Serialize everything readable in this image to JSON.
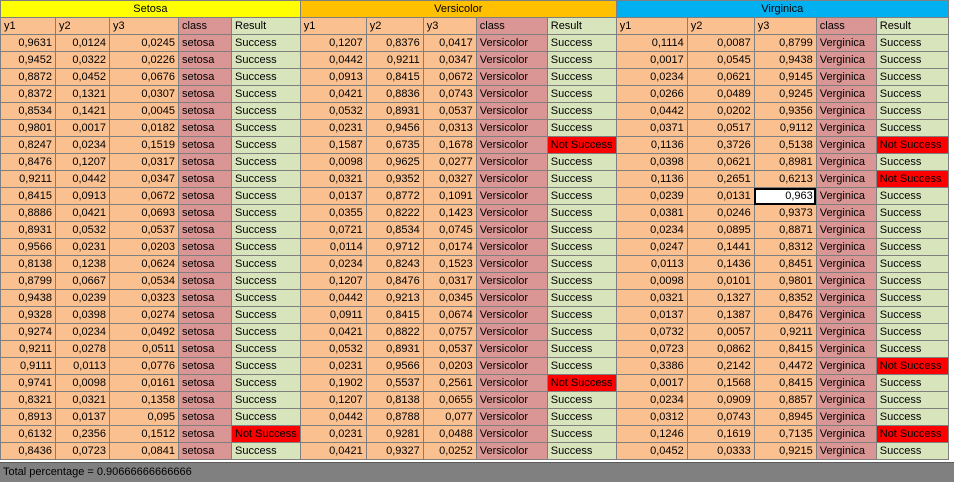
{
  "groups": [
    {
      "label": "Setosa"
    },
    {
      "label": "Versicolor"
    },
    {
      "label": "Virginica"
    }
  ],
  "headers": [
    "y1",
    "y2",
    "y3",
    "class",
    "Result"
  ],
  "rows": [
    [
      [
        "0,9631",
        "0,0124",
        "0,0245",
        "setosa",
        "Success"
      ],
      [
        "0,1207",
        "0,8376",
        "0,0417",
        "Versicolor",
        "Success"
      ],
      [
        "0,1114",
        "0,0087",
        "0,8799",
        "Verginica",
        "Success"
      ]
    ],
    [
      [
        "0,9452",
        "0,0322",
        "0,0226",
        "setosa",
        "Success"
      ],
      [
        "0,0442",
        "0,9211",
        "0,0347",
        "Versicolor",
        "Success"
      ],
      [
        "0,0017",
        "0,0545",
        "0,9438",
        "Verginica",
        "Success"
      ]
    ],
    [
      [
        "0,8872",
        "0,0452",
        "0,0676",
        "setosa",
        "Success"
      ],
      [
        "0,0913",
        "0,8415",
        "0,0672",
        "Versicolor",
        "Success"
      ],
      [
        "0,0234",
        "0,0621",
        "0,9145",
        "Verginica",
        "Success"
      ]
    ],
    [
      [
        "0,8372",
        "0,1321",
        "0,0307",
        "setosa",
        "Success"
      ],
      [
        "0,0421",
        "0,8836",
        "0,0743",
        "Versicolor",
        "Success"
      ],
      [
        "0,0266",
        "0,0489",
        "0,9245",
        "Verginica",
        "Success"
      ]
    ],
    [
      [
        "0,8534",
        "0,1421",
        "0,0045",
        "setosa",
        "Success"
      ],
      [
        "0,0532",
        "0,8931",
        "0,0537",
        "Versicolor",
        "Success"
      ],
      [
        "0,0442",
        "0,0202",
        "0,9356",
        "Verginica",
        "Success"
      ]
    ],
    [
      [
        "0,9801",
        "0,0017",
        "0,0182",
        "setosa",
        "Success"
      ],
      [
        "0,0231",
        "0,9456",
        "0,0313",
        "Versicolor",
        "Success"
      ],
      [
        "0,0371",
        "0,0517",
        "0,9112",
        "Verginica",
        "Success"
      ]
    ],
    [
      [
        "0,8247",
        "0,0234",
        "0,1519",
        "setosa",
        "Success"
      ],
      [
        "0,1587",
        "0,6735",
        "0,1678",
        "Versicolor",
        "Not Success"
      ],
      [
        "0,1136",
        "0,3726",
        "0,5138",
        "Verginica",
        "Not Success"
      ]
    ],
    [
      [
        "0,8476",
        "0,1207",
        "0,0317",
        "setosa",
        "Success"
      ],
      [
        "0,0098",
        "0,9625",
        "0,0277",
        "Versicolor",
        "Success"
      ],
      [
        "0,0398",
        "0,0621",
        "0,8981",
        "Verginica",
        "Success"
      ]
    ],
    [
      [
        "0,9211",
        "0,0442",
        "0,0347",
        "setosa",
        "Success"
      ],
      [
        "0,0321",
        "0,9352",
        "0,0327",
        "Versicolor",
        "Success"
      ],
      [
        "0,1136",
        "0,2651",
        "0,6213",
        "Verginica",
        "Not Success"
      ]
    ],
    [
      [
        "0,8415",
        "0,0913",
        "0,0672",
        "setosa",
        "Success"
      ],
      [
        "0,0137",
        "0,8772",
        "0,1091",
        "Versicolor",
        "Success"
      ],
      [
        "0,0239",
        "0,0131",
        "0,963",
        "Verginica",
        "Success"
      ]
    ],
    [
      [
        "0,8886",
        "0,0421",
        "0,0693",
        "setosa",
        "Success"
      ],
      [
        "0,0355",
        "0,8222",
        "0,1423",
        "Versicolor",
        "Success"
      ],
      [
        "0,0381",
        "0,0246",
        "0,9373",
        "Verginica",
        "Success"
      ]
    ],
    [
      [
        "0,8931",
        "0,0532",
        "0,0537",
        "setosa",
        "Success"
      ],
      [
        "0,0721",
        "0,8534",
        "0,0745",
        "Versicolor",
        "Success"
      ],
      [
        "0,0234",
        "0,0895",
        "0,8871",
        "Verginica",
        "Success"
      ]
    ],
    [
      [
        "0,9566",
        "0,0231",
        "0,0203",
        "setosa",
        "Success"
      ],
      [
        "0,0114",
        "0,9712",
        "0,0174",
        "Versicolor",
        "Success"
      ],
      [
        "0,0247",
        "0,1441",
        "0,8312",
        "Verginica",
        "Success"
      ]
    ],
    [
      [
        "0,8138",
        "0,1238",
        "0,0624",
        "setosa",
        "Success"
      ],
      [
        "0,0234",
        "0,8243",
        "0,1523",
        "Versicolor",
        "Success"
      ],
      [
        "0,0113",
        "0,1436",
        "0,8451",
        "Verginica",
        "Success"
      ]
    ],
    [
      [
        "0,8799",
        "0,0667",
        "0,0534",
        "setosa",
        "Success"
      ],
      [
        "0,1207",
        "0,8476",
        "0,0317",
        "Versicolor",
        "Success"
      ],
      [
        "0,0098",
        "0,0101",
        "0,9801",
        "Verginica",
        "Success"
      ]
    ],
    [
      [
        "0,9438",
        "0,0239",
        "0,0323",
        "setosa",
        "Success"
      ],
      [
        "0,0442",
        "0,9213",
        "0,0345",
        "Versicolor",
        "Success"
      ],
      [
        "0,0321",
        "0,1327",
        "0,8352",
        "Verginica",
        "Success"
      ]
    ],
    [
      [
        "0,9328",
        "0,0398",
        "0,0274",
        "setosa",
        "Success"
      ],
      [
        "0,0911",
        "0,8415",
        "0,0674",
        "Versicolor",
        "Success"
      ],
      [
        "0,0137",
        "0,1387",
        "0,8476",
        "Verginica",
        "Success"
      ]
    ],
    [
      [
        "0,9274",
        "0,0234",
        "0,0492",
        "setosa",
        "Success"
      ],
      [
        "0,0421",
        "0,8822",
        "0,0757",
        "Versicolor",
        "Success"
      ],
      [
        "0,0732",
        "0,0057",
        "0,9211",
        "Verginica",
        "Success"
      ]
    ],
    [
      [
        "0,9211",
        "0,0278",
        "0,0511",
        "setosa",
        "Success"
      ],
      [
        "0,0532",
        "0,8931",
        "0,0537",
        "Versicolor",
        "Success"
      ],
      [
        "0,0723",
        "0,0862",
        "0,8415",
        "Verginica",
        "Success"
      ]
    ],
    [
      [
        "0,9111",
        "0,0113",
        "0,0776",
        "setosa",
        "Success"
      ],
      [
        "0,0231",
        "0,9566",
        "0,0203",
        "Versicolor",
        "Success"
      ],
      [
        "0,3386",
        "0,2142",
        "0,4472",
        "Verginica",
        "Not Success"
      ]
    ],
    [
      [
        "0,9741",
        "0,0098",
        "0,0161",
        "setosa",
        "Success"
      ],
      [
        "0,1902",
        "0,5537",
        "0,2561",
        "Versicolor",
        "Not Success"
      ],
      [
        "0,0017",
        "0,1568",
        "0,8415",
        "Verginica",
        "Success"
      ]
    ],
    [
      [
        "0,8321",
        "0,0321",
        "0,1358",
        "setosa",
        "Success"
      ],
      [
        "0,1207",
        "0,8138",
        "0,0655",
        "Versicolor",
        "Success"
      ],
      [
        "0,0234",
        "0,0909",
        "0,8857",
        "Verginica",
        "Success"
      ]
    ],
    [
      [
        "0,8913",
        "0,0137",
        "0,095",
        "setosa",
        "Success"
      ],
      [
        "0,0442",
        "0,8788",
        "0,077",
        "Versicolor",
        "Success"
      ],
      [
        "0,0312",
        "0,0743",
        "0,8945",
        "Verginica",
        "Success"
      ]
    ],
    [
      [
        "0,6132",
        "0,2356",
        "0,1512",
        "setosa",
        "Not Success"
      ],
      [
        "0,0231",
        "0,9281",
        "0,0488",
        "Versicolor",
        "Success"
      ],
      [
        "0,1246",
        "0,1619",
        "0,7135",
        "Verginica",
        "Not Success"
      ]
    ],
    [
      [
        "0,8436",
        "0,0723",
        "0,0841",
        "setosa",
        "Success"
      ],
      [
        "0,0421",
        "0,9327",
        "0,0252",
        "Versicolor",
        "Success"
      ],
      [
        "0,0452",
        "0,0333",
        "0,9215",
        "Verginica",
        "Success"
      ]
    ]
  ],
  "selected_cell": {
    "row": 9,
    "group": 2,
    "col": 2
  },
  "status_text": "Total percentage = 0.90666666666666",
  "colors": {
    "setosa_header": "#ffff00",
    "versicolor_header": "#ffc000",
    "virginica_header": "#00b0f0",
    "number_cell": "#fac090",
    "class_cell": "#da9694",
    "result_cell": "#d8e4bc",
    "fail_cell": "#ff0000",
    "status_bar": "#808080"
  }
}
